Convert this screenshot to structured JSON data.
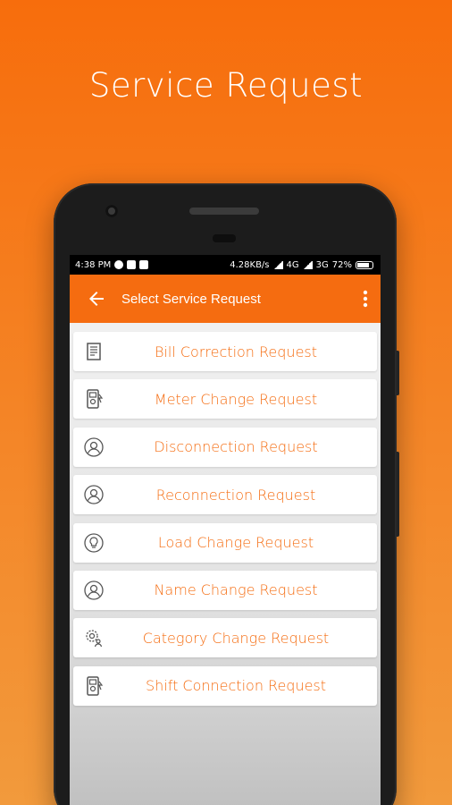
{
  "promo": {
    "title": "Service Request"
  },
  "status_bar": {
    "time": "4:38 PM",
    "network_speed": "4.28KB/s",
    "net1": "4G",
    "net2": "3G",
    "battery": "72%"
  },
  "app_bar": {
    "title": "Select Service Request",
    "back_icon": "arrow-left-icon",
    "menu_icon": "more-vert-icon"
  },
  "requests": [
    {
      "label": "Bill Correction Request",
      "icon": "bill-icon"
    },
    {
      "label": "Meter Change Request",
      "icon": "meter-icon"
    },
    {
      "label": "Disconnection Request",
      "icon": "user-icon"
    },
    {
      "label": "Reconnection Request",
      "icon": "user-icon"
    },
    {
      "label": "Load Change Request",
      "icon": "bulb-icon"
    },
    {
      "label": "Name Change Request",
      "icon": "user-icon"
    },
    {
      "label": "Category Change Request",
      "icon": "gear-user-icon"
    },
    {
      "label": "Shift Connection Request",
      "icon": "meter-icon"
    }
  ],
  "colors": {
    "accent": "#f56c10",
    "background_top": "#f76d0c",
    "background_bottom": "#f29a3c"
  }
}
